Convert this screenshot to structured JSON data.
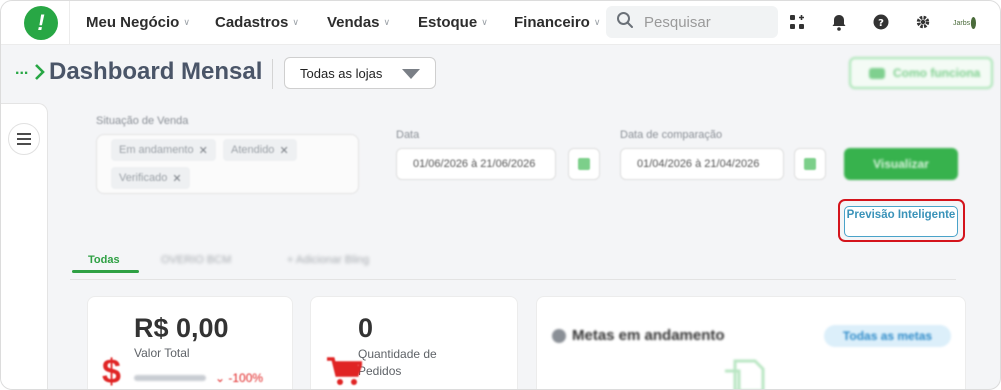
{
  "nav": {
    "items": [
      {
        "label": "Meu Negócio"
      },
      {
        "label": "Cadastros"
      },
      {
        "label": "Vendas"
      },
      {
        "label": "Estoque"
      },
      {
        "label": "Financeiro"
      }
    ],
    "search_placeholder": "Pesquisar",
    "avatar_text": "Jarbs"
  },
  "header": {
    "breadcrumb": "...",
    "title": "Dashboard Mensal",
    "store_select": "Todas as lojas",
    "how_it_works": "Como funciona"
  },
  "filters": {
    "status_label": "Situação de Venda",
    "chips": [
      "Em andamento",
      "Atendido",
      "Verificado"
    ],
    "date_label": "Data",
    "date_value": "01/06/2026 à 21/06/2026",
    "compare_label": "Data de comparação",
    "compare_value": "01/04/2026 à 21/04/2026",
    "visualizar": "Visualizar",
    "previsao": "Previsão Inteligente"
  },
  "tabs": [
    "Todas",
    "OVERIO BCM",
    "+ Adicionar Bling"
  ],
  "cards": {
    "revenue_value": "R$ 0,00",
    "revenue_label": "Valor Total",
    "revenue_trend": "-100%",
    "orders_value": "0",
    "orders_label": "Quantidade de Pedidos",
    "goals_title": "Metas em andamento",
    "goals_button": "Todas as metas"
  },
  "colors": {
    "brand_green": "#28a745",
    "highlight_red": "#d4141c",
    "info_blue": "#3a93b9"
  }
}
